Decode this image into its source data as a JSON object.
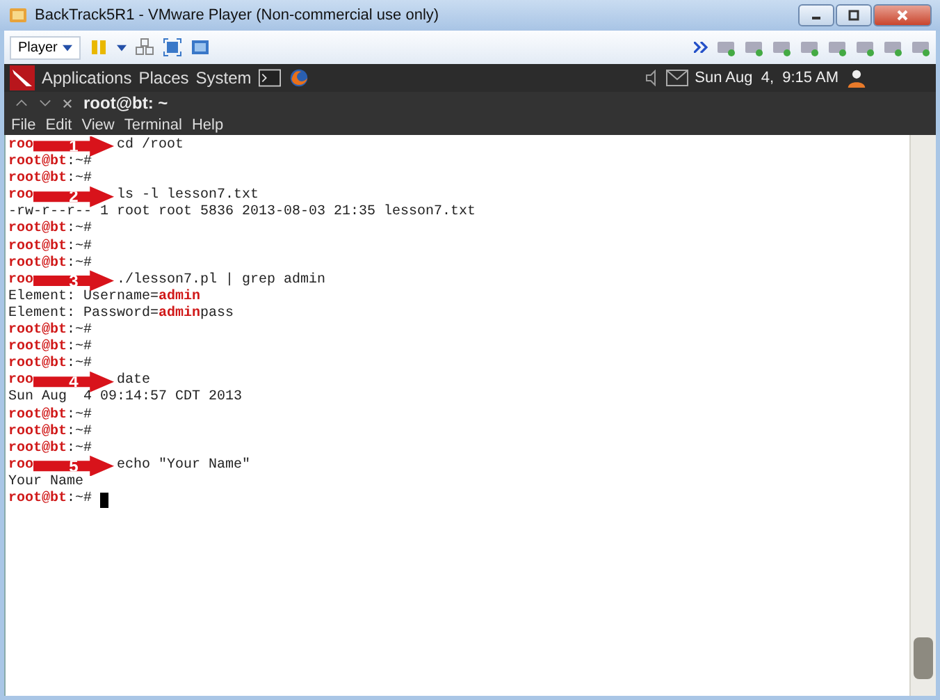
{
  "window": {
    "title": "BackTrack5R1 - VMware Player (Non-commercial use only)"
  },
  "toolbar": {
    "player_menu": "Player"
  },
  "panel": {
    "menus": [
      "Applications",
      "Places",
      "System"
    ],
    "clock": "Sun Aug  4,  9:15 AM"
  },
  "terminal": {
    "title": "root@bt: ~",
    "menu": [
      "File",
      "Edit",
      "View",
      "Terminal",
      "Help"
    ],
    "lines": [
      {
        "kind": "step",
        "prompt": "roo",
        "step": "1",
        "command": "cd /root"
      },
      {
        "kind": "prompt",
        "user": "root@bt",
        "path": ":~#"
      },
      {
        "kind": "prompt",
        "user": "root@bt",
        "path": ":~#"
      },
      {
        "kind": "step",
        "prompt": "roo",
        "step": "2",
        "command": "ls -l lesson7.txt"
      },
      {
        "kind": "output",
        "segments": [
          {
            "text": "-rw-r--r-- 1 root root 5836 2013-08-03 21:35 lesson7.txt",
            "highlight": false
          }
        ]
      },
      {
        "kind": "prompt",
        "user": "root@bt",
        "path": ":~#"
      },
      {
        "kind": "prompt",
        "user": "root@bt",
        "path": ":~#"
      },
      {
        "kind": "prompt",
        "user": "root@bt",
        "path": ":~#"
      },
      {
        "kind": "step",
        "prompt": "roo",
        "step": "3",
        "command": "./lesson7.pl | grep admin"
      },
      {
        "kind": "output",
        "segments": [
          {
            "text": "Element: Username=",
            "highlight": false
          },
          {
            "text": "admin",
            "highlight": true
          }
        ]
      },
      {
        "kind": "output",
        "segments": [
          {
            "text": "Element: Password=",
            "highlight": false
          },
          {
            "text": "admin",
            "highlight": true
          },
          {
            "text": "pass",
            "highlight": false
          }
        ]
      },
      {
        "kind": "prompt",
        "user": "root@bt",
        "path": ":~#"
      },
      {
        "kind": "prompt",
        "user": "root@bt",
        "path": ":~#"
      },
      {
        "kind": "prompt",
        "user": "root@bt",
        "path": ":~#"
      },
      {
        "kind": "step",
        "prompt": "roo",
        "step": "4",
        "command": "date"
      },
      {
        "kind": "output",
        "segments": [
          {
            "text": "Sun Aug  4 09:14:57 CDT 2013",
            "highlight": false
          }
        ]
      },
      {
        "kind": "prompt",
        "user": "root@bt",
        "path": ":~#"
      },
      {
        "kind": "prompt",
        "user": "root@bt",
        "path": ":~#"
      },
      {
        "kind": "prompt",
        "user": "root@bt",
        "path": ":~#"
      },
      {
        "kind": "step",
        "prompt": "roo",
        "step": "5",
        "command": "echo \"Your Name\""
      },
      {
        "kind": "output",
        "segments": [
          {
            "text": "Your Name",
            "highlight": false
          }
        ]
      },
      {
        "kind": "prompt",
        "user": "root@bt",
        "path": ":~#",
        "cursor": true
      }
    ]
  }
}
